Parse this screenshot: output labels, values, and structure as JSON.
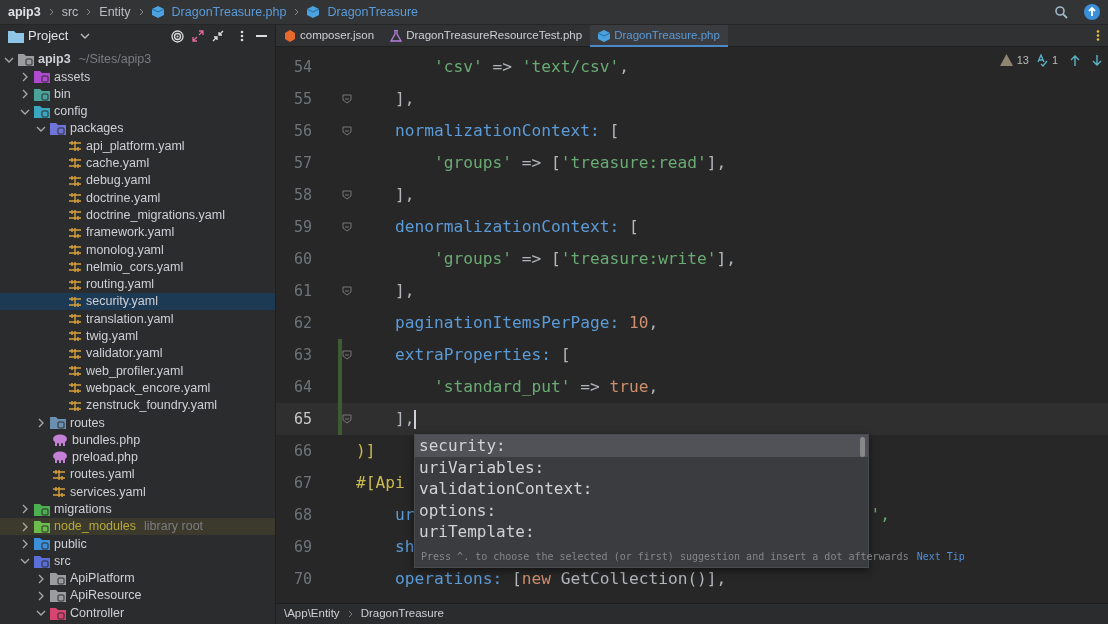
{
  "breadcrumb": [
    {
      "text": "apip3",
      "kind": "root"
    },
    {
      "text": "src",
      "kind": "dir"
    },
    {
      "text": "Entity",
      "kind": "dir"
    },
    {
      "text": "DragonTreasure.php",
      "kind": "file"
    },
    {
      "text": "DragonTreasure",
      "kind": "class"
    }
  ],
  "project_panel": {
    "title": "Project"
  },
  "tabs": [
    {
      "label": "composer.json",
      "kind": "json",
      "selected": false
    },
    {
      "label": "DragonTreasureResourceTest.php",
      "kind": "test",
      "selected": false
    },
    {
      "label": "DragonTreasure.php",
      "kind": "php",
      "selected": true
    }
  ],
  "tree": [
    {
      "label": "apip3",
      "hint": "~/Sites/apip3",
      "kind": "folder",
      "color": "#9a9da0",
      "expanded": true,
      "selected": false,
      "children": [
        {
          "label": "assets",
          "kind": "folder",
          "color": "#b04ad0",
          "expanded": false,
          "selected": false
        },
        {
          "label": "bin",
          "kind": "folder",
          "color": "#4aa39a",
          "expanded": false,
          "selected": false
        },
        {
          "label": "config",
          "kind": "folder",
          "color": "#3aa6c2",
          "expanded": true,
          "selected": false,
          "children": [
            {
              "label": "packages",
              "kind": "folder",
              "color": "#6f74d8",
              "expanded": true,
              "selected": false,
              "children": [
                {
                  "label": "api_platform.yaml",
                  "kind": "yaml",
                  "selected": false
                },
                {
                  "label": "cache.yaml",
                  "kind": "yaml",
                  "selected": false
                },
                {
                  "label": "debug.yaml",
                  "kind": "yaml",
                  "selected": false
                },
                {
                  "label": "doctrine.yaml",
                  "kind": "yaml",
                  "selected": false
                },
                {
                  "label": "doctrine_migrations.yaml",
                  "kind": "yaml",
                  "selected": false
                },
                {
                  "label": "framework.yaml",
                  "kind": "yaml",
                  "selected": false
                },
                {
                  "label": "monolog.yaml",
                  "kind": "yaml",
                  "selected": false
                },
                {
                  "label": "nelmio_cors.yaml",
                  "kind": "yaml",
                  "selected": false
                },
                {
                  "label": "routing.yaml",
                  "kind": "yaml",
                  "selected": false
                },
                {
                  "label": "security.yaml",
                  "kind": "yaml",
                  "selected": true
                },
                {
                  "label": "translation.yaml",
                  "kind": "yaml",
                  "selected": false
                },
                {
                  "label": "twig.yaml",
                  "kind": "yaml",
                  "selected": false
                },
                {
                  "label": "validator.yaml",
                  "kind": "yaml",
                  "selected": false
                },
                {
                  "label": "web_profiler.yaml",
                  "kind": "yaml",
                  "selected": false
                },
                {
                  "label": "webpack_encore.yaml",
                  "kind": "yaml",
                  "selected": false
                },
                {
                  "label": "zenstruck_foundry.yaml",
                  "kind": "yaml",
                  "selected": false
                }
              ]
            },
            {
              "label": "routes",
              "kind": "folder",
              "color": "#6a8fb0",
              "expanded": false,
              "selected": false
            },
            {
              "label": "bundles.php",
              "kind": "php",
              "selected": false
            },
            {
              "label": "preload.php",
              "kind": "php",
              "selected": false
            },
            {
              "label": "routes.yaml",
              "kind": "yaml",
              "selected": false
            },
            {
              "label": "services.yaml",
              "kind": "yaml",
              "selected": false
            }
          ]
        },
        {
          "label": "migrations",
          "kind": "folder",
          "color": "#4caf50",
          "expanded": false,
          "selected": false
        },
        {
          "label": "node_modules",
          "hint": "library root",
          "kind": "library",
          "color": "#6dbb4a",
          "expanded": false,
          "selected": false
        },
        {
          "label": "public",
          "kind": "folder",
          "color": "#3d8fd8",
          "expanded": false,
          "selected": false
        },
        {
          "label": "src",
          "kind": "folder",
          "color": "#5a6fd8",
          "expanded": true,
          "selected": false,
          "children": [
            {
              "label": "ApiPlatform",
              "kind": "folder",
              "color": "#9a9da0",
              "expanded": false,
              "selected": false
            },
            {
              "label": "ApiResource",
              "kind": "folder",
              "color": "#9a9da0",
              "expanded": false,
              "selected": false
            },
            {
              "label": "Controller",
              "kind": "folder",
              "color": "#d64570",
              "expanded": true,
              "selected": false
            }
          ]
        }
      ]
    }
  ],
  "inspections": {
    "warnings": "13",
    "typos": "1"
  },
  "code_lines": [
    {
      "n": "54",
      "fold": false,
      "changed": false,
      "tokens": [
        {
          "text": "        'csv'",
          "kind": "string"
        },
        {
          "text": " => ",
          "kind": "plain"
        },
        {
          "text": "'text/csv'",
          "kind": "string"
        },
        {
          "text": ",",
          "kind": "plain"
        }
      ]
    },
    {
      "n": "55",
      "fold": true,
      "changed": false,
      "tokens": [
        {
          "text": "    ],",
          "kind": "plain"
        }
      ]
    },
    {
      "n": "56",
      "fold": true,
      "changed": false,
      "tokens": [
        {
          "text": "    normalizationContext:",
          "kind": "key"
        },
        {
          "text": " [",
          "kind": "plain"
        }
      ]
    },
    {
      "n": "57",
      "fold": false,
      "changed": false,
      "tokens": [
        {
          "text": "        'groups'",
          "kind": "string"
        },
        {
          "text": " => [",
          "kind": "plain"
        },
        {
          "text": "'treasure:read'",
          "kind": "string"
        },
        {
          "text": "],",
          "kind": "plain"
        }
      ]
    },
    {
      "n": "58",
      "fold": true,
      "changed": false,
      "tokens": [
        {
          "text": "    ],",
          "kind": "plain"
        }
      ]
    },
    {
      "n": "59",
      "fold": true,
      "changed": false,
      "tokens": [
        {
          "text": "    denormalizationContext:",
          "kind": "key"
        },
        {
          "text": " [",
          "kind": "plain"
        }
      ]
    },
    {
      "n": "60",
      "fold": false,
      "changed": false,
      "tokens": [
        {
          "text": "        'groups'",
          "kind": "string"
        },
        {
          "text": " => [",
          "kind": "plain"
        },
        {
          "text": "'treasure:write'",
          "kind": "string"
        },
        {
          "text": "],",
          "kind": "plain"
        }
      ]
    },
    {
      "n": "61",
      "fold": true,
      "changed": false,
      "tokens": [
        {
          "text": "    ],",
          "kind": "plain"
        }
      ]
    },
    {
      "n": "62",
      "fold": false,
      "changed": false,
      "tokens": [
        {
          "text": "    paginationItemsPerPage:",
          "kind": "key"
        },
        {
          "text": " 10",
          "kind": "literal"
        },
        {
          "text": ",",
          "kind": "plain"
        }
      ]
    },
    {
      "n": "63",
      "fold": true,
      "changed": true,
      "tokens": [
        {
          "text": "    extraProperties:",
          "kind": "key"
        },
        {
          "text": " [",
          "kind": "plain"
        }
      ]
    },
    {
      "n": "64",
      "fold": false,
      "changed": true,
      "tokens": [
        {
          "text": "        'standard_put'",
          "kind": "string"
        },
        {
          "text": " => ",
          "kind": "plain"
        },
        {
          "text": "true",
          "kind": "literal"
        },
        {
          "text": ",",
          "kind": "plain"
        }
      ]
    },
    {
      "n": "65",
      "fold": true,
      "changed": true,
      "current": true,
      "tokens": [
        {
          "text": "    ],",
          "kind": "plain"
        }
      ]
    },
    {
      "n": "66",
      "fold": false,
      "changed": false,
      "tokens": [
        {
          "text": ")]",
          "kind": "attribute"
        }
      ]
    },
    {
      "n": "67",
      "fold": false,
      "changed": false,
      "tokens": [
        {
          "text": "#[Api",
          "kind": "attribute"
        }
      ]
    },
    {
      "n": "68",
      "fold": false,
      "changed": false,
      "tokens": [
        {
          "text": "    ur",
          "kind": "key"
        },
        {
          "text": "',",
          "kind": "string",
          "tail": true
        }
      ]
    },
    {
      "n": "69",
      "fold": false,
      "changed": false,
      "tokens": [
        {
          "text": "    sh",
          "kind": "key"
        }
      ]
    },
    {
      "n": "70",
      "fold": false,
      "changed": false,
      "tokens": [
        {
          "text": "    operations:",
          "kind": "key"
        },
        {
          "text": " [",
          "kind": "plain"
        },
        {
          "text": "new",
          "kind": "literal"
        },
        {
          "text": " GetCollection()],",
          "kind": "plain"
        }
      ]
    }
  ],
  "completion": {
    "items": [
      {
        "label": "security:",
        "selected": true
      },
      {
        "label": "uriVariables:",
        "selected": false
      },
      {
        "label": "validationContext:",
        "selected": false
      },
      {
        "label": "options:",
        "selected": false
      },
      {
        "label": "uriTemplate:",
        "selected": false
      }
    ],
    "hint": "Press ^. to choose the selected (or first) suggestion and insert a dot afterwards",
    "link": "Next Tip"
  },
  "status_bar": [
    "\\App\\Entity",
    "DragonTreasure"
  ]
}
